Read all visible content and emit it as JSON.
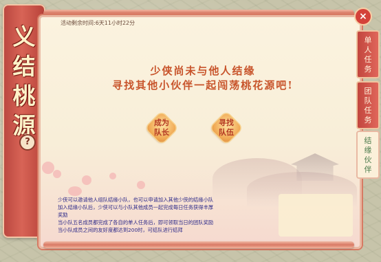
{
  "header": {
    "timer": "活动剩余时间:6天11小时22分"
  },
  "banner": {
    "title_chars": [
      "义",
      "结",
      "桃",
      "源"
    ],
    "help_label": "?"
  },
  "main": {
    "message_line1": "少侠尚未与他人结缘",
    "message_line2": "寻找其他小伙伴一起闯荡桃花源吧!",
    "become_leader": {
      "line1": "成为",
      "line2": "队长"
    },
    "find_team": {
      "line1": "寻找",
      "line2": "队伍"
    }
  },
  "description": {
    "line1": "少侠可以邀请他人组队结缘小队，也可以申请加入其他少侠的结缘小队",
    "line2": "加入结缘小队后，少侠可以与小队其他成员一起完成每日任务获得丰厚",
    "line3": "奖励",
    "line4": "当小队五名成员都完成了各自的单人任务后，即可领取当日的团队奖励",
    "line5": "当小队成员之间的友好度都达到200时，可结队进行结拜"
  },
  "tabs": {
    "single": [
      "单",
      "人",
      "任",
      "务"
    ],
    "team": [
      "团",
      "队",
      "任",
      "务"
    ],
    "partner": [
      "结",
      "缘",
      "伙",
      "伴"
    ]
  },
  "close_label": "×",
  "colors": {
    "accent_red": "#c2463e",
    "title_orange": "#c8542b",
    "text_blue": "#2d2a8a"
  }
}
